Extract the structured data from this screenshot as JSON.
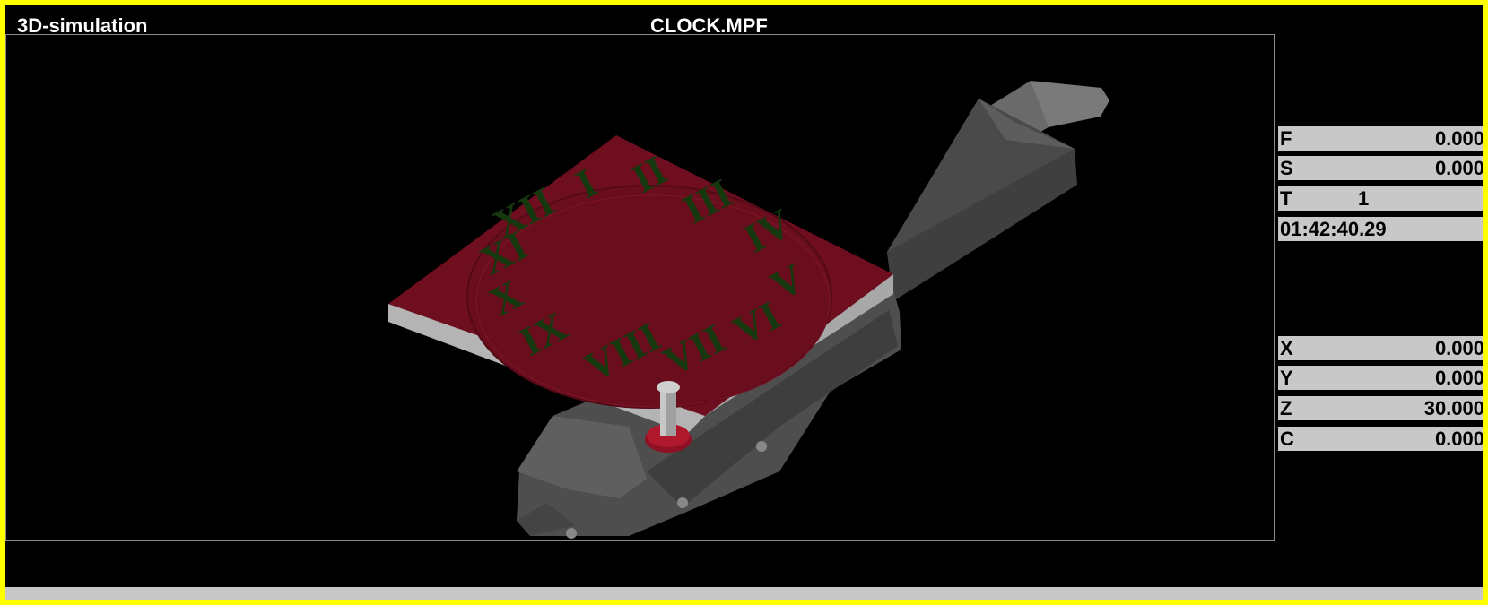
{
  "window": {
    "app_title": "3D-simulation",
    "program_name": "CLOCK.MPF"
  },
  "machine_values": {
    "feed": {
      "label": "F",
      "value": "0.000"
    },
    "spindle": {
      "label": "S",
      "value": "0.000"
    },
    "tool": {
      "label": "T",
      "value": "1"
    },
    "time": "01:42:40.29"
  },
  "axes": [
    {
      "label": "X",
      "value": "0.000"
    },
    {
      "label": "Y",
      "value": "0.000"
    },
    {
      "label": "Z",
      "value": "30.000"
    },
    {
      "label": "C",
      "value": "0.000"
    }
  ],
  "clock_numerals": [
    "I",
    "II",
    "III",
    "IV",
    "V",
    "VI",
    "VII",
    "VIII",
    "IX",
    "X",
    "XI",
    "XII"
  ],
  "colors": {
    "frame": "#ffff00",
    "workpiece": "#6e0e1e",
    "engraving": "#16380f",
    "machine": "#5a5a5a",
    "panel": "#c8c8c8"
  }
}
